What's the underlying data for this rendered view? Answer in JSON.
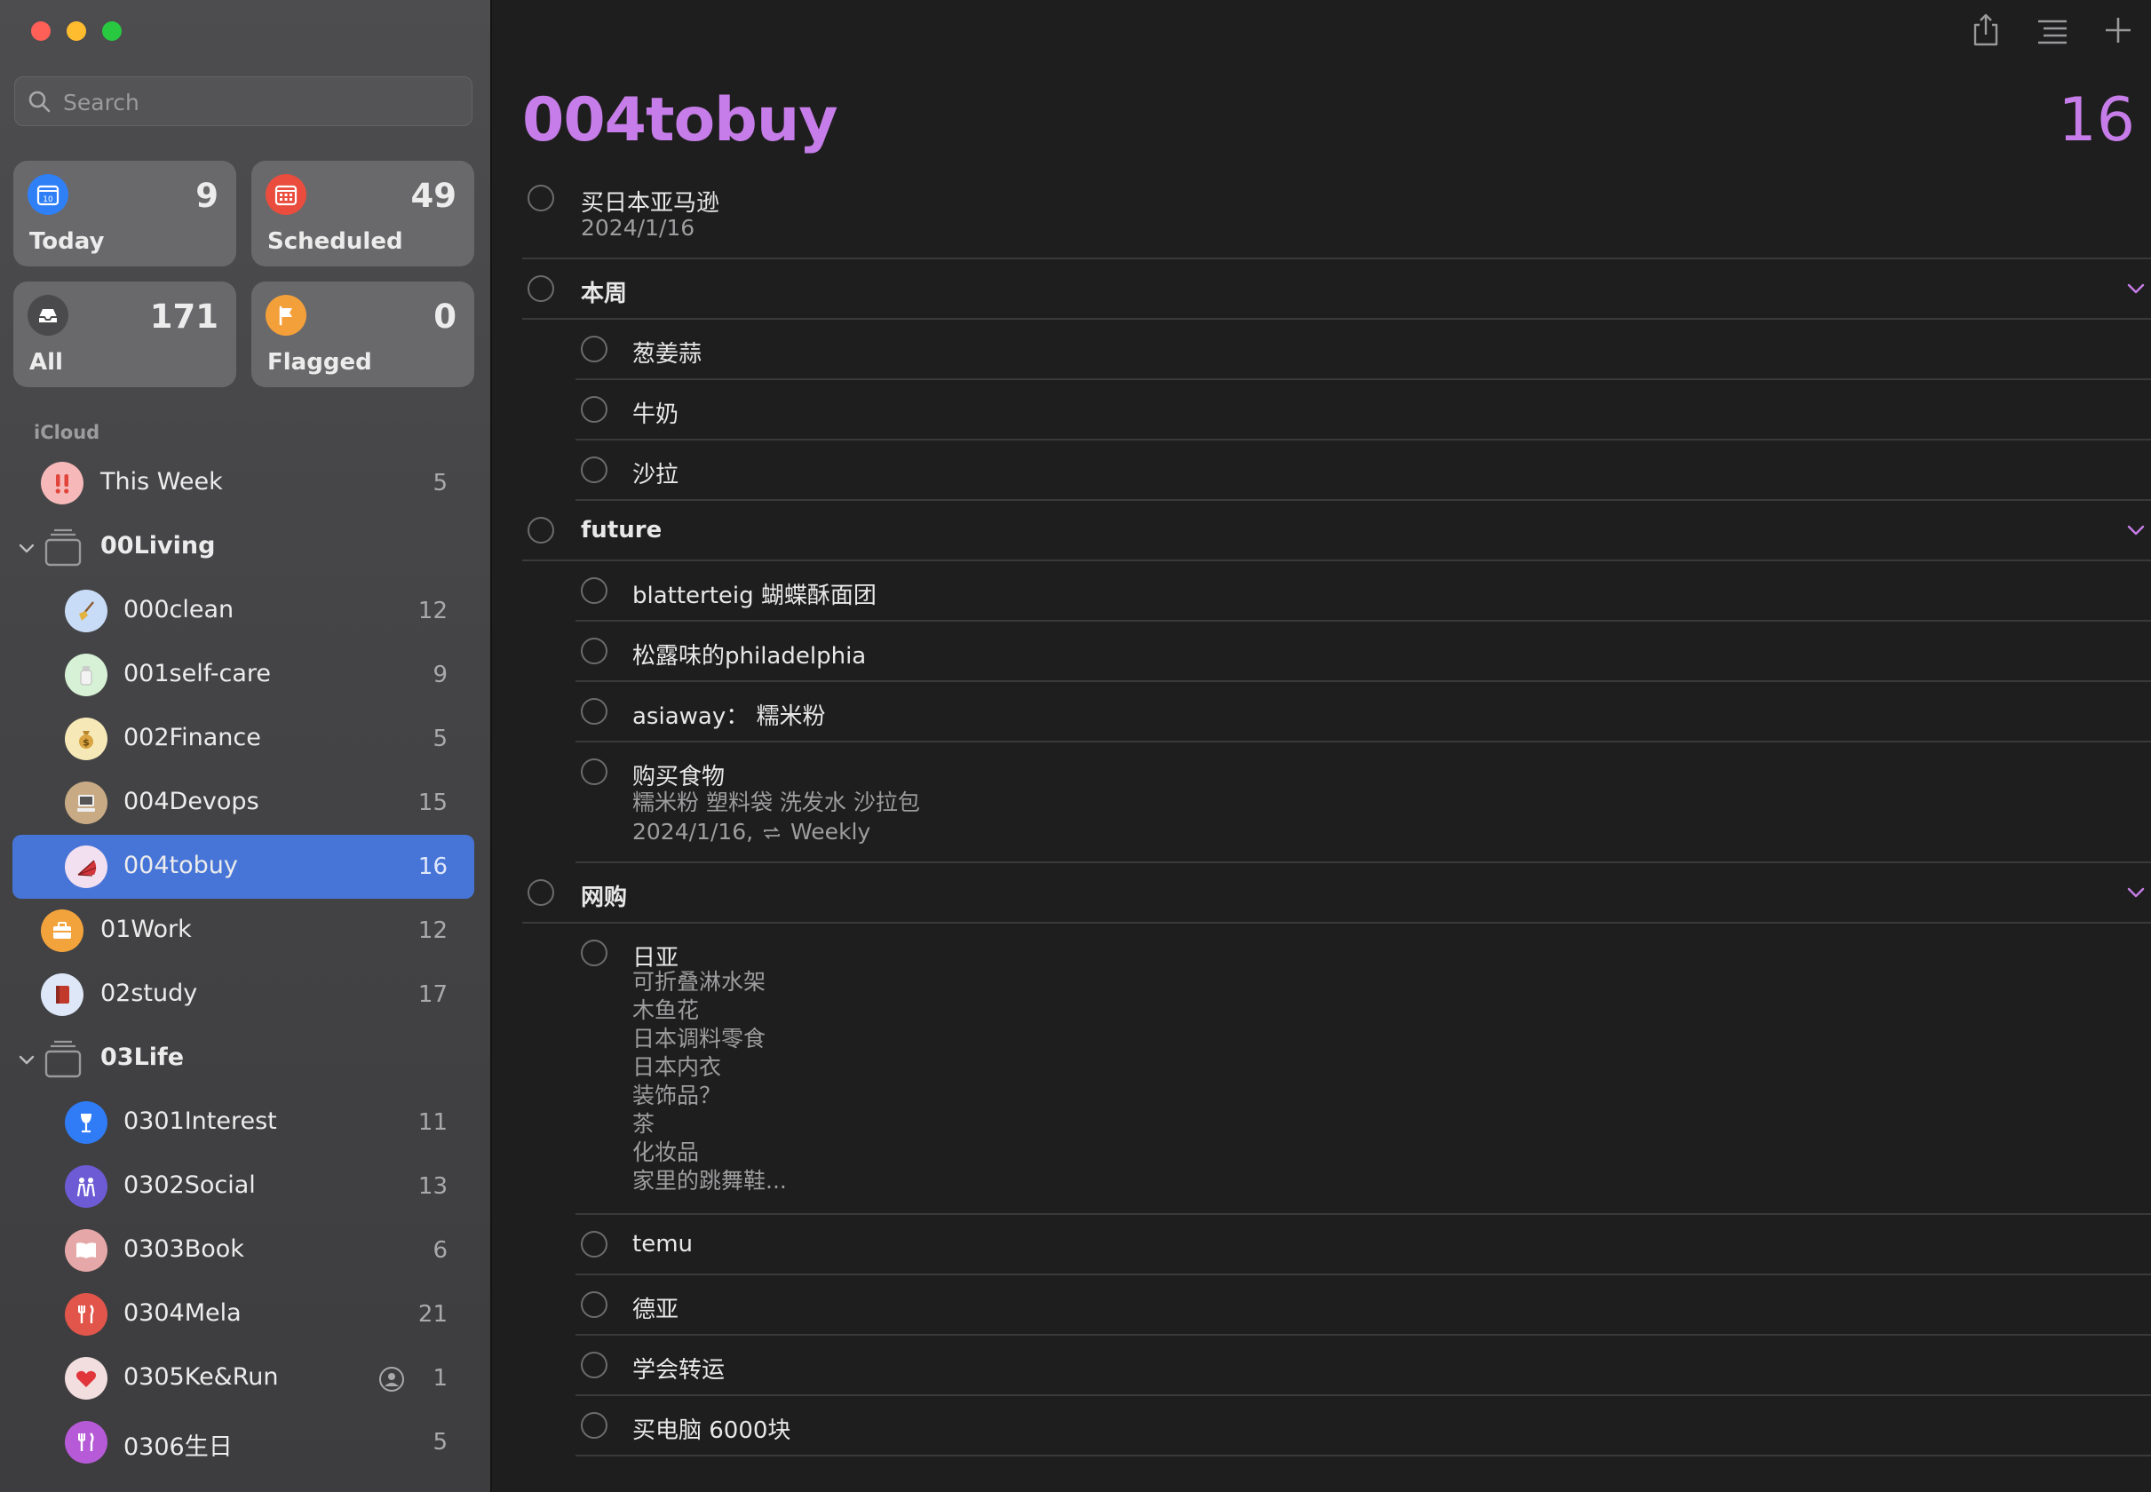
{
  "window": {
    "controls": [
      "close",
      "minimize",
      "zoom"
    ]
  },
  "search": {
    "placeholder": "Search"
  },
  "smart_lists": [
    {
      "label": "Today",
      "count": "9",
      "icon": "calendar-today-icon",
      "color": "#2f80f7"
    },
    {
      "label": "Scheduled",
      "count": "49",
      "icon": "calendar-icon",
      "color": "#ea4d3d"
    },
    {
      "label": "All",
      "count": "171",
      "icon": "tray-icon",
      "color": "#4a4a4c"
    },
    {
      "label": "Flagged",
      "count": "0",
      "icon": "flag-icon",
      "color": "#f4a03a"
    }
  ],
  "sidebar": {
    "section": "iCloud",
    "rows": [
      {
        "name": "This Week",
        "count": "5",
        "icon": "exclamation-icon",
        "color": "#f6b8b8"
      },
      {
        "name": "00Living",
        "count": "",
        "icon": "group-folder-icon"
      },
      {
        "name": "000clean",
        "count": "12",
        "icon": "broom-icon",
        "color": "#c9dcf7"
      },
      {
        "name": "001self-care",
        "count": "9",
        "icon": "bottle-icon",
        "color": "#d6f1d6"
      },
      {
        "name": "002Finance",
        "count": "5",
        "icon": "money-bag-icon",
        "color": "#f6e9b7"
      },
      {
        "name": "004Devops",
        "count": "15",
        "icon": "computer-icon",
        "color": "#c8ab84"
      },
      {
        "name": "004tobuy",
        "count": "16",
        "icon": "fan-icon",
        "color": "#f2dfef"
      },
      {
        "name": "01Work",
        "count": "12",
        "icon": "briefcase-icon",
        "color": "#f3a33c"
      },
      {
        "name": "02study",
        "count": "17",
        "icon": "book-icon",
        "color": "#dde7f7"
      },
      {
        "name": "03Life",
        "count": "",
        "icon": "group-folder-icon"
      },
      {
        "name": "0301Interest",
        "count": "11",
        "icon": "wine-glass-icon",
        "color": "#2f7cf6"
      },
      {
        "name": "0302Social",
        "count": "13",
        "icon": "people-icon",
        "color": "#6d5bd6"
      },
      {
        "name": "0303Book",
        "count": "6",
        "icon": "open-book-icon",
        "color": "#e5a7a7"
      },
      {
        "name": "0304Mela",
        "count": "21",
        "icon": "fork-knife-icon",
        "color": "#e2554a"
      },
      {
        "name": "0305Ke&Run",
        "count": "1",
        "icon": "heart-icon",
        "color": "#f2dede"
      },
      {
        "name": "0306生日",
        "count": "5",
        "icon": "fork-knife-icon",
        "color": "#b65ad8"
      }
    ]
  },
  "main": {
    "title": "004tobuy",
    "count": "16",
    "accent": "#c77de9",
    "tasks": [
      {
        "title": "买日本亚马逊",
        "subtitle": "2024/1/16"
      },
      {
        "title": "本周"
      },
      {
        "title": "葱姜蒜"
      },
      {
        "title": "牛奶"
      },
      {
        "title": "沙拉"
      },
      {
        "title": "future"
      },
      {
        "title": "blatterteig 蝴蝶酥面团"
      },
      {
        "title": "松露味的philadelphia"
      },
      {
        "title": "asiaway： 糯米粉"
      },
      {
        "title": "购买食物",
        "notes": "糯米粉 塑料袋 洗发水 沙拉包",
        "subtitle_date": "2024/1/16,",
        "subtitle_repeat": "Weekly"
      },
      {
        "title": "网购"
      },
      {
        "title": "日亚",
        "notes": "可折叠淋水架\n木鱼花\n日本调料零食\n日本内衣\n装饰品？\n茶\n化妆品\n家里的跳舞鞋..."
      },
      {
        "title": "temu"
      },
      {
        "title": "德亚"
      },
      {
        "title": "学会转运"
      },
      {
        "title": "买电脑 6000块"
      }
    ]
  }
}
